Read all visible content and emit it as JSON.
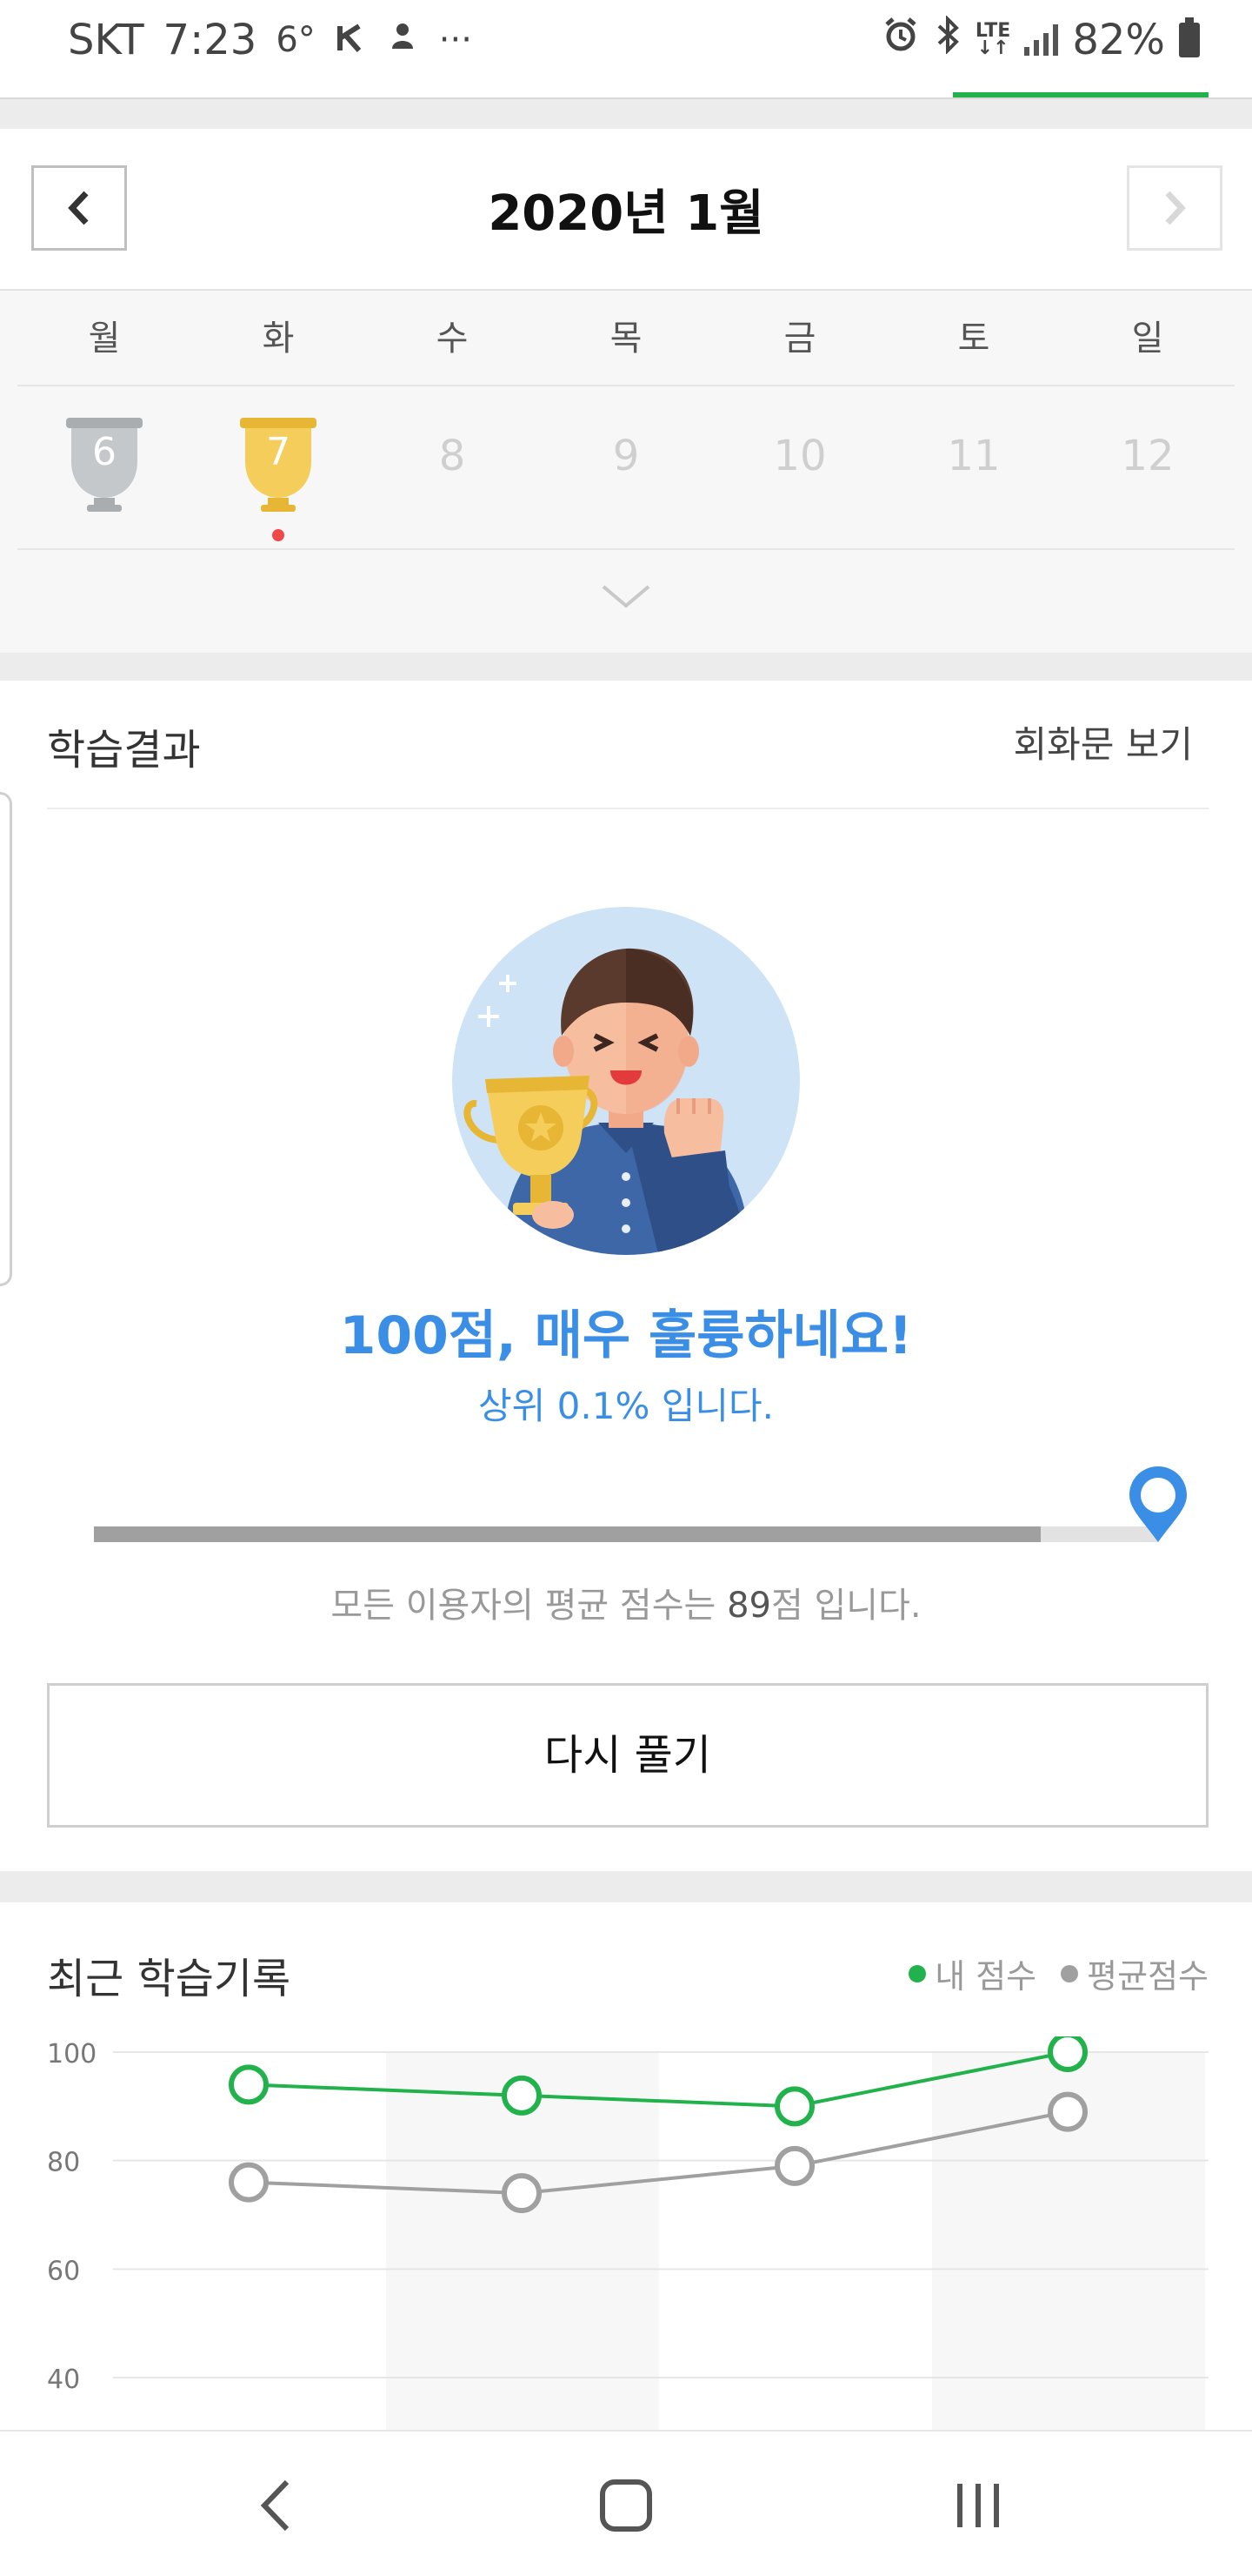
{
  "status_bar": {
    "carrier": "SKT",
    "time": "7:23",
    "temperature": "6°",
    "more": "···",
    "network": "LTE",
    "battery": "82%"
  },
  "calendar": {
    "month_title": "2020년 1월",
    "weekdays": [
      "월",
      "화",
      "수",
      "목",
      "금",
      "토",
      "일"
    ],
    "dates": [
      "6",
      "7",
      "8",
      "9",
      "10",
      "11",
      "12"
    ]
  },
  "result": {
    "title": "학습결과",
    "view_dialog": "회화문 보기",
    "score_message": "100점, 매우 훌륭하네요!",
    "rank_message": "상위 0.1% 입니다.",
    "my_score": 100,
    "average_score": 89,
    "avg_prefix": "모든 이용자의 평균 점수는 ",
    "avg_value": "89",
    "avg_suffix": "점 입니다.",
    "retry_label": "다시 풀기"
  },
  "recent": {
    "title": "최근 학습기록",
    "legend_mine": "내 점수",
    "legend_avg": "평균점수"
  },
  "colors": {
    "accent_green": "#22b24c",
    "accent_blue": "#3a8ee6",
    "avg_gray": "#a0a0a0",
    "trophy_gold": "#f5cd5a",
    "trophy_silver": "#bfc3c6"
  },
  "chart_data": {
    "type": "line",
    "ylim": [
      40,
      100
    ],
    "yticks": [
      "100",
      "80",
      "60",
      "40"
    ],
    "series": [
      {
        "name": "내 점수",
        "values": [
          94,
          92,
          90,
          100
        ]
      },
      {
        "name": "평균점수",
        "values": [
          76,
          74,
          79,
          89
        ]
      }
    ],
    "legend_position": "top-right",
    "grid": true
  }
}
